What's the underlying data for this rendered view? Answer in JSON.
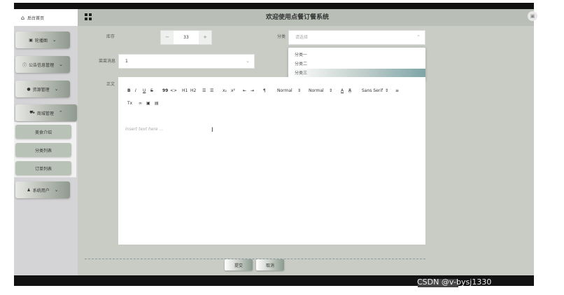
{
  "header": {
    "home_label": "后台首页",
    "app_title": "欢迎使用点餐订餐系统"
  },
  "sidebar": {
    "items": [
      {
        "label": "轮播图",
        "icon": "image-icon"
      },
      {
        "label": "公告信息管理",
        "icon": "info-icon"
      },
      {
        "label": "资源管理",
        "icon": "pin-icon"
      },
      {
        "label": "商城管理",
        "icon": "cart-icon"
      },
      {
        "label": "系统用户",
        "icon": "user-icon"
      }
    ],
    "sub_items": [
      "美食介绍",
      "分类列表",
      "订单列表"
    ]
  },
  "form": {
    "stock_label": "库存",
    "stock_value": "33",
    "category_label": "分类",
    "category_placeholder": "请选择",
    "category_options": [
      "分类一",
      "分类二",
      "分类三"
    ],
    "category_selected_index": 2,
    "info_label": "菜菜消息",
    "info_value": "1",
    "body_label": "正文",
    "editor_placeholder": "Insert text here ...",
    "toolbar": {
      "bold": "B",
      "italic": "I",
      "underline": "U",
      "strike": "S",
      "quote": "99",
      "code": "<>",
      "h1": "H1",
      "h2": "H2",
      "ol": "☰",
      "ul": "☰",
      "sub": "x₂",
      "sup": "x²",
      "indent_left": "⇤",
      "indent_right": "⇥",
      "rtl": "¶",
      "size": "Normal",
      "header": "Normal",
      "color": "A",
      "bg": "A",
      "font": "Sans Serif",
      "align": "≡",
      "clean": "Tx",
      "link": "🔗",
      "image": "▣",
      "video": "▤"
    }
  },
  "actions": {
    "submit": "提交",
    "cancel": "取消"
  },
  "watermark": "CSDN @v-bysj1330"
}
